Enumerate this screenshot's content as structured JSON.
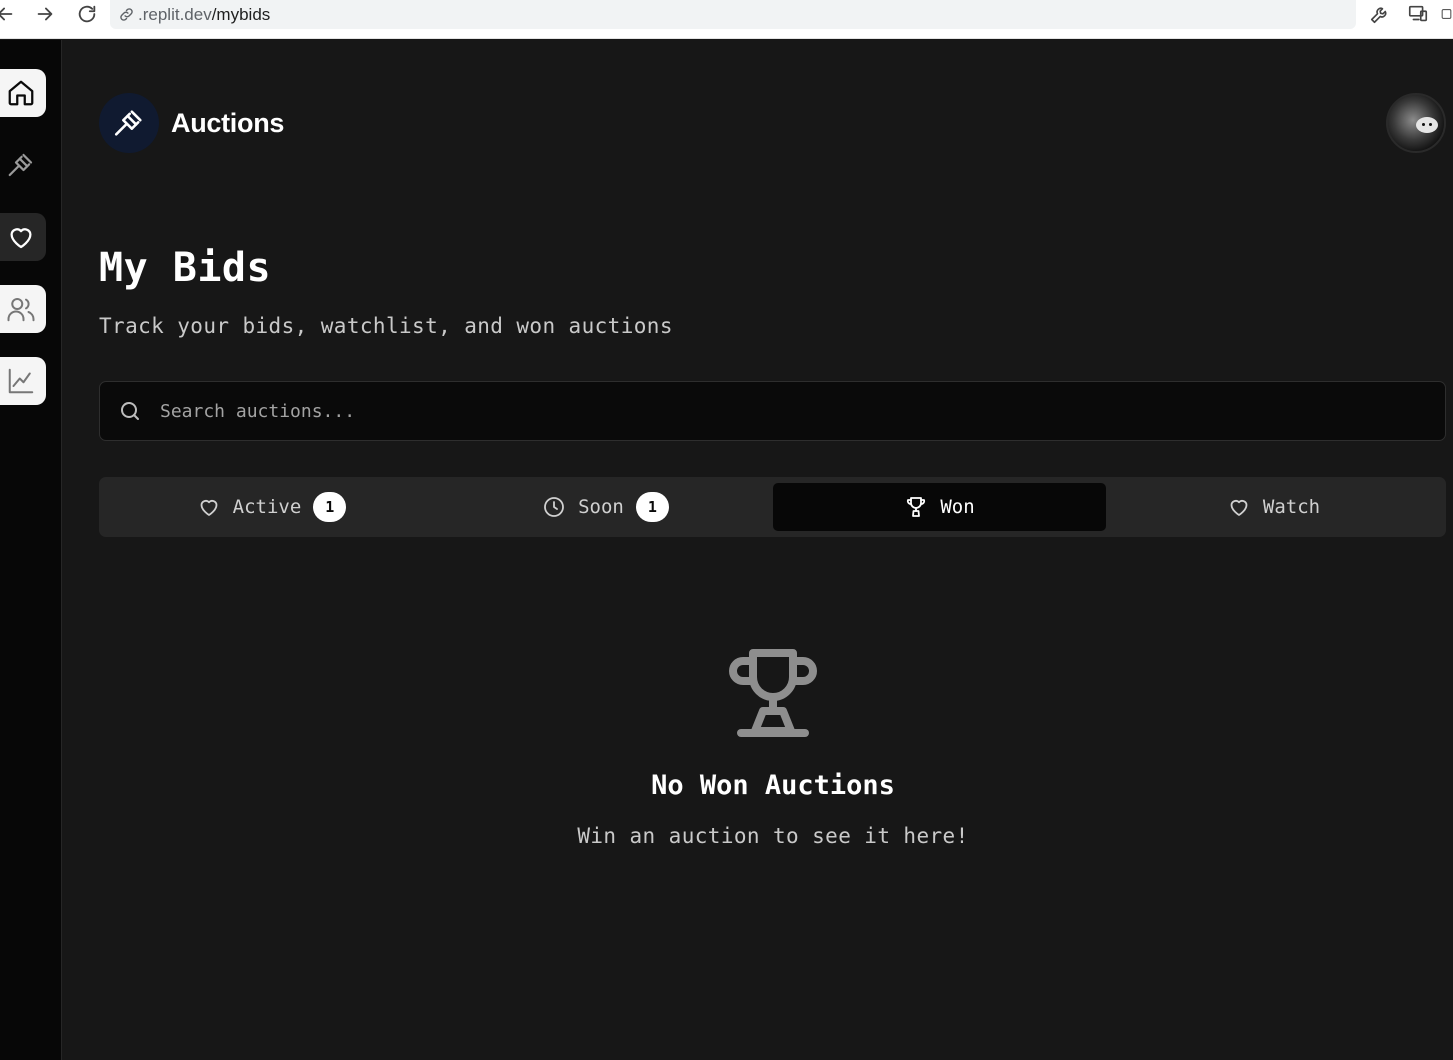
{
  "browser": {
    "url_prefix": ".replit.dev",
    "url_path": "/mybids"
  },
  "header": {
    "app_name": "Auctions"
  },
  "page": {
    "title": "My Bids",
    "subtitle": "Track your bids, watchlist, and won auctions"
  },
  "search": {
    "placeholder": "Search auctions..."
  },
  "tabs": [
    {
      "label": "Active",
      "count": "1",
      "icon": "heart-icon"
    },
    {
      "label": "Soon",
      "count": "1",
      "icon": "clock-icon"
    },
    {
      "label": "Won",
      "icon": "trophy-icon",
      "selected": true
    },
    {
      "label": "Watch",
      "icon": "heart-icon"
    }
  ],
  "empty_state": {
    "title": "No Won Auctions",
    "message": "Win an auction to see it here!",
    "icon": "trophy-icon"
  },
  "sidebar": {
    "items": [
      {
        "icon": "home-icon"
      },
      {
        "icon": "gavel-icon"
      },
      {
        "icon": "heart-icon"
      },
      {
        "icon": "users-icon"
      },
      {
        "icon": "chart-icon"
      }
    ]
  },
  "colors": {
    "background": "#171717",
    "rail": "#070707",
    "tab_active": "#070707",
    "tab_bar": "#262626",
    "brand_logo_bg": "#101a30"
  }
}
